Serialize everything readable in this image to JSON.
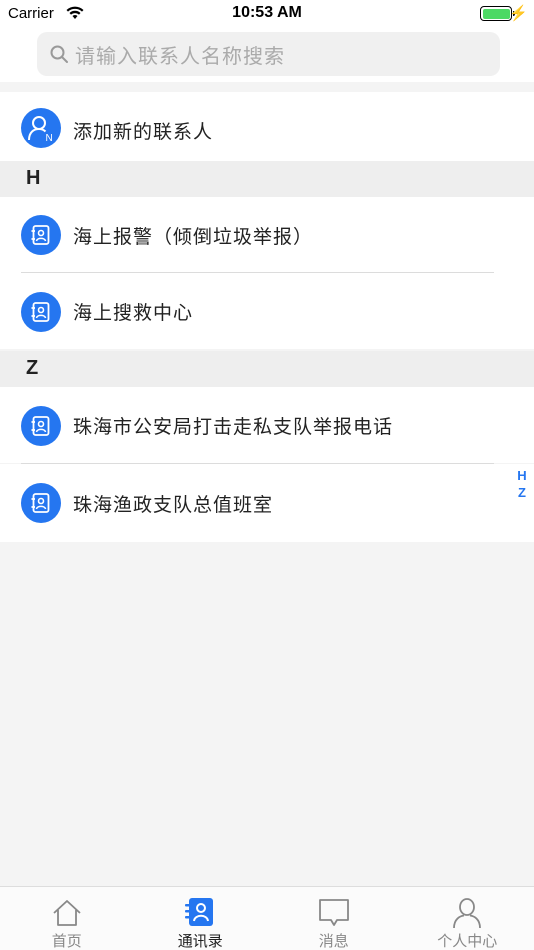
{
  "status_bar": {
    "carrier": "Carrier",
    "time": "10:53 AM"
  },
  "search": {
    "placeholder": "请输入联系人名称搜索"
  },
  "add_contact": {
    "label": "添加新的联系人",
    "icon": "add-person-icon"
  },
  "sections": [
    {
      "letter": "H",
      "items": [
        {
          "label": "海上报警（倾倒垃圾举报）",
          "icon": "contact-book-icon"
        },
        {
          "label": "海上搜救中心",
          "icon": "contact-book-icon"
        }
      ]
    },
    {
      "letter": "Z",
      "items": [
        {
          "label": "珠海市公安局打击走私支队举报电话",
          "icon": "contact-book-icon"
        },
        {
          "label": "珠海渔政支队总值班室",
          "icon": "contact-book-icon"
        }
      ]
    }
  ],
  "index_bar": [
    "H",
    "Z"
  ],
  "tabs": [
    {
      "label": "首页",
      "icon": "home-icon",
      "active": false
    },
    {
      "label": "通讯录",
      "icon": "contacts-icon",
      "active": true
    },
    {
      "label": "消息",
      "icon": "message-icon",
      "active": false
    },
    {
      "label": "个人中心",
      "icon": "person-icon",
      "active": false
    }
  ],
  "colors": {
    "accent": "#2576f0",
    "section_bg": "#eeeeee",
    "battery": "#4cd964"
  }
}
